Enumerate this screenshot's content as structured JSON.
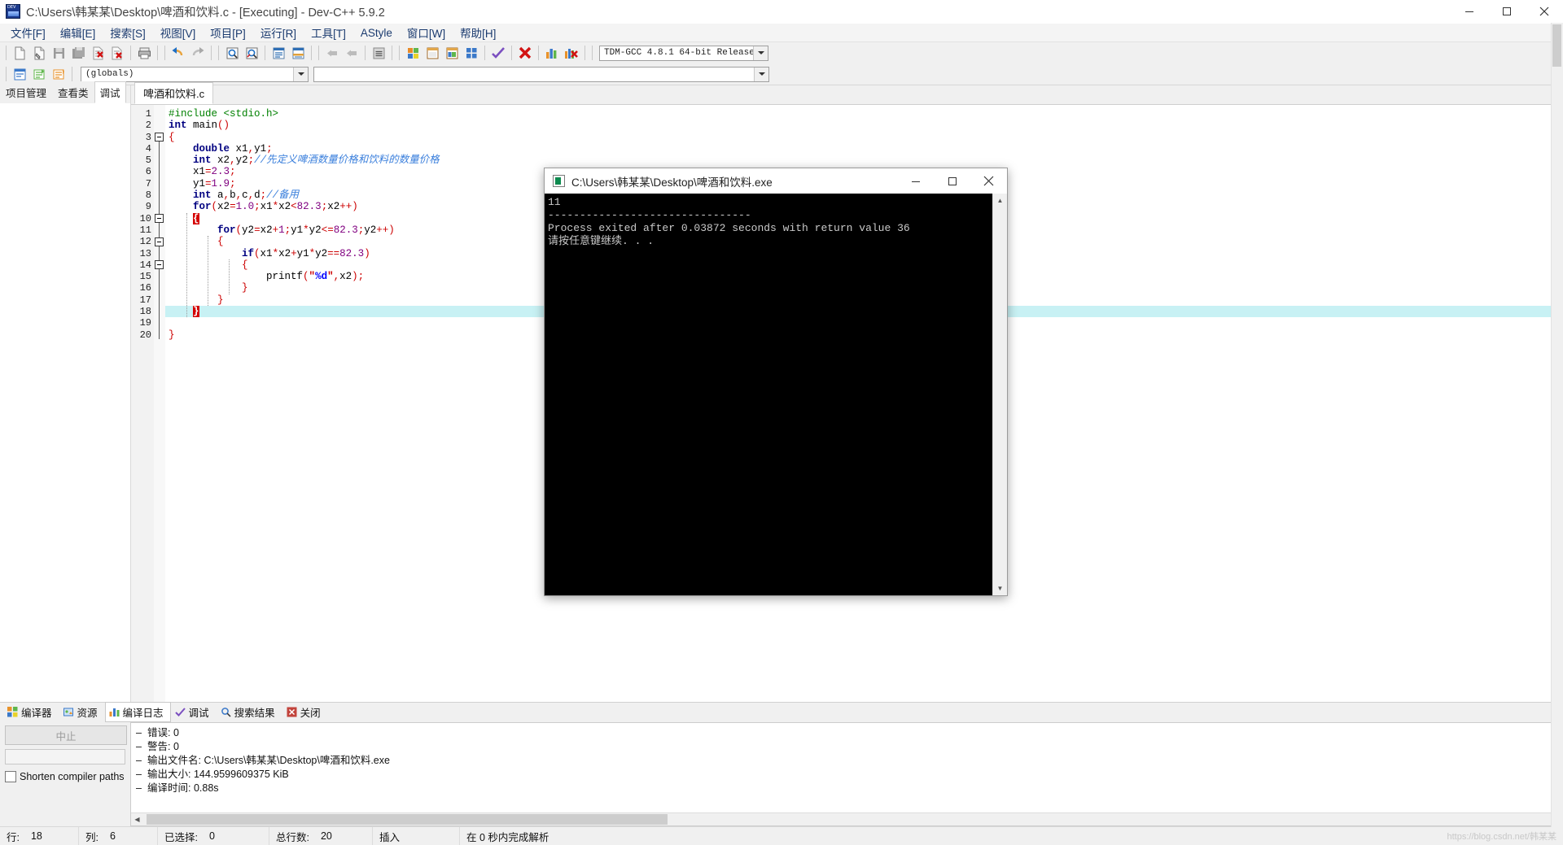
{
  "window": {
    "title": "C:\\Users\\韩某某\\Desktop\\啤酒和饮料.c - [Executing] - Dev-C++ 5.9.2",
    "minimize": "–",
    "maximize": "□",
    "close": "✕"
  },
  "menu": {
    "items": [
      {
        "label": "文件[F]",
        "name": "menu-file"
      },
      {
        "label": "编辑[E]",
        "name": "menu-edit"
      },
      {
        "label": "搜索[S]",
        "name": "menu-search"
      },
      {
        "label": "视图[V]",
        "name": "menu-view"
      },
      {
        "label": "项目[P]",
        "name": "menu-project"
      },
      {
        "label": "运行[R]",
        "name": "menu-run"
      },
      {
        "label": "工具[T]",
        "name": "menu-tools"
      },
      {
        "label": "AStyle",
        "name": "menu-astyle"
      },
      {
        "label": "窗口[W]",
        "name": "menu-window"
      },
      {
        "label": "帮助[H]",
        "name": "menu-help"
      }
    ]
  },
  "toolbar": {
    "compiler_combo": "TDM-GCC 4.8.1 64-bit Release",
    "globals_combo": "(globals)",
    "symbol_combo": ""
  },
  "left_panel": {
    "tabs": [
      {
        "label": "项目管理",
        "name": "tab-project-manager"
      },
      {
        "label": "查看类",
        "name": "tab-class-browser"
      },
      {
        "label": "调试",
        "name": "tab-debug"
      }
    ],
    "active": "调试"
  },
  "editor": {
    "tab_label": "啤酒和饮料.c",
    "current_line": 18,
    "total_lines": 20,
    "lines": [
      {
        "n": 1,
        "tokens": [
          {
            "t": "#include <stdio.h>",
            "c": "pp"
          }
        ]
      },
      {
        "n": 2,
        "tokens": [
          {
            "t": "int",
            "c": "k"
          },
          {
            "t": " main",
            "c": "id"
          },
          {
            "t": "()",
            "c": "op"
          }
        ]
      },
      {
        "n": 3,
        "tokens": [
          {
            "t": "{",
            "c": "op"
          }
        ]
      },
      {
        "n": 4,
        "tokens": [
          {
            "t": "    ",
            "c": "id"
          },
          {
            "t": "double",
            "c": "k"
          },
          {
            "t": " x1",
            "c": "id"
          },
          {
            "t": ",",
            "c": "op"
          },
          {
            "t": "y1",
            "c": "id"
          },
          {
            "t": ";",
            "c": "op"
          }
        ]
      },
      {
        "n": 5,
        "tokens": [
          {
            "t": "    ",
            "c": "id"
          },
          {
            "t": "int",
            "c": "k"
          },
          {
            "t": " x2",
            "c": "id"
          },
          {
            "t": ",",
            "c": "op"
          },
          {
            "t": "y2",
            "c": "id"
          },
          {
            "t": ";",
            "c": "op"
          },
          {
            "t": "//先定义啤酒数量价格和饮料的数量价格",
            "c": "cm"
          }
        ]
      },
      {
        "n": 6,
        "tokens": [
          {
            "t": "    x1",
            "c": "id"
          },
          {
            "t": "=",
            "c": "op"
          },
          {
            "t": "2.3",
            "c": "num"
          },
          {
            "t": ";",
            "c": "op"
          }
        ]
      },
      {
        "n": 7,
        "tokens": [
          {
            "t": "    y1",
            "c": "id"
          },
          {
            "t": "=",
            "c": "op"
          },
          {
            "t": "1.9",
            "c": "num"
          },
          {
            "t": ";",
            "c": "op"
          }
        ]
      },
      {
        "n": 8,
        "tokens": [
          {
            "t": "    ",
            "c": "id"
          },
          {
            "t": "int",
            "c": "k"
          },
          {
            "t": " a",
            "c": "id"
          },
          {
            "t": ",",
            "c": "op"
          },
          {
            "t": "b",
            "c": "id"
          },
          {
            "t": ",",
            "c": "op"
          },
          {
            "t": "c",
            "c": "id"
          },
          {
            "t": ",",
            "c": "op"
          },
          {
            "t": "d",
            "c": "id"
          },
          {
            "t": ";",
            "c": "op"
          },
          {
            "t": "//备用",
            "c": "cm"
          }
        ]
      },
      {
        "n": 9,
        "tokens": [
          {
            "t": "    ",
            "c": "id"
          },
          {
            "t": "for",
            "c": "k"
          },
          {
            "t": "(",
            "c": "op"
          },
          {
            "t": "x2",
            "c": "id"
          },
          {
            "t": "=",
            "c": "op"
          },
          {
            "t": "1.0",
            "c": "num"
          },
          {
            "t": ";",
            "c": "op"
          },
          {
            "t": "x1",
            "c": "id"
          },
          {
            "t": "*",
            "c": "op"
          },
          {
            "t": "x2",
            "c": "id"
          },
          {
            "t": "<",
            "c": "op"
          },
          {
            "t": "82.3",
            "c": "num"
          },
          {
            "t": ";",
            "c": "op"
          },
          {
            "t": "x2",
            "c": "id"
          },
          {
            "t": "++)",
            "c": "op"
          }
        ]
      },
      {
        "n": 10,
        "tokens": [
          {
            "t": "    ",
            "c": "id"
          },
          {
            "t": "{",
            "c": "bracehl"
          }
        ]
      },
      {
        "n": 11,
        "tokens": [
          {
            "t": "        ",
            "c": "id"
          },
          {
            "t": "for",
            "c": "k"
          },
          {
            "t": "(",
            "c": "op"
          },
          {
            "t": "y2",
            "c": "id"
          },
          {
            "t": "=",
            "c": "op"
          },
          {
            "t": "x2",
            "c": "id"
          },
          {
            "t": "+",
            "c": "op"
          },
          {
            "t": "1",
            "c": "num"
          },
          {
            "t": ";",
            "c": "op"
          },
          {
            "t": "y1",
            "c": "id"
          },
          {
            "t": "*",
            "c": "op"
          },
          {
            "t": "y2",
            "c": "id"
          },
          {
            "t": "<=",
            "c": "op"
          },
          {
            "t": "82.3",
            "c": "num"
          },
          {
            "t": ";",
            "c": "op"
          },
          {
            "t": "y2",
            "c": "id"
          },
          {
            "t": "++)",
            "c": "op"
          }
        ]
      },
      {
        "n": 12,
        "tokens": [
          {
            "t": "        ",
            "c": "id"
          },
          {
            "t": "{",
            "c": "op"
          }
        ]
      },
      {
        "n": 13,
        "tokens": [
          {
            "t": "            ",
            "c": "id"
          },
          {
            "t": "if",
            "c": "k"
          },
          {
            "t": "(",
            "c": "op"
          },
          {
            "t": "x1",
            "c": "id"
          },
          {
            "t": "*",
            "c": "op"
          },
          {
            "t": "x2",
            "c": "id"
          },
          {
            "t": "+",
            "c": "op"
          },
          {
            "t": "y1",
            "c": "id"
          },
          {
            "t": "*",
            "c": "op"
          },
          {
            "t": "y2",
            "c": "id"
          },
          {
            "t": "==",
            "c": "op"
          },
          {
            "t": "82.3",
            "c": "num"
          },
          {
            "t": ")",
            "c": "op"
          }
        ]
      },
      {
        "n": 14,
        "tokens": [
          {
            "t": "            ",
            "c": "id"
          },
          {
            "t": "{",
            "c": "op"
          }
        ]
      },
      {
        "n": 15,
        "tokens": [
          {
            "t": "                printf",
            "c": "id"
          },
          {
            "t": "(",
            "c": "op"
          },
          {
            "t": "\"",
            "c": "stq"
          },
          {
            "t": "%d",
            "c": "st"
          },
          {
            "t": "\"",
            "c": "stq"
          },
          {
            "t": ",",
            "c": "op"
          },
          {
            "t": "x2",
            "c": "id"
          },
          {
            "t": ")",
            "c": "op"
          },
          {
            "t": ";",
            "c": "op"
          }
        ]
      },
      {
        "n": 16,
        "tokens": [
          {
            "t": "            ",
            "c": "id"
          },
          {
            "t": "}",
            "c": "op"
          }
        ]
      },
      {
        "n": 17,
        "tokens": [
          {
            "t": "        ",
            "c": "id"
          },
          {
            "t": "}",
            "c": "op"
          }
        ]
      },
      {
        "n": 18,
        "tokens": [
          {
            "t": "    ",
            "c": "id"
          },
          {
            "t": "}",
            "c": "bracehl"
          }
        ]
      },
      {
        "n": 19,
        "tokens": []
      },
      {
        "n": 20,
        "tokens": [
          {
            "t": "}",
            "c": "op"
          }
        ]
      }
    ]
  },
  "console": {
    "title": "C:\\Users\\韩某某\\Desktop\\啤酒和饮料.exe",
    "minimize": "–",
    "maximize": "□",
    "close": "✕",
    "lines": [
      "11",
      "--------------------------------",
      "Process exited after 0.03872 seconds with return value 36",
      "请按任意键继续. . ."
    ]
  },
  "bottom_panel": {
    "tabs": [
      {
        "label": "编译器",
        "name": "tab-compiler"
      },
      {
        "label": "资源",
        "name": "tab-resources"
      },
      {
        "label": "编译日志",
        "name": "tab-compile-log"
      },
      {
        "label": "调试",
        "name": "tab-debug-log"
      },
      {
        "label": "搜索结果",
        "name": "tab-search-results"
      },
      {
        "label": "关闭",
        "name": "tab-close"
      }
    ],
    "active": "编译日志",
    "abort_button": "中止",
    "shorten_checkbox": "Shorten compiler paths",
    "log": [
      "错误: 0",
      "警告: 0",
      "输出文件名: C:\\Users\\韩某某\\Desktop\\啤酒和饮料.exe",
      "输出大小: 144.9599609375 KiB",
      "编译时间: 0.88s"
    ]
  },
  "statusbar": {
    "cells": [
      {
        "label": "行:",
        "value": "18",
        "name": "status-row"
      },
      {
        "label": "列:",
        "value": "6",
        "name": "status-col"
      },
      {
        "label": "已选择:",
        "value": "0",
        "name": "status-selected"
      },
      {
        "label": "总行数:",
        "value": "20",
        "name": "status-total-lines"
      },
      {
        "label": "插入",
        "value": "",
        "name": "status-insert-mode"
      },
      {
        "label": "在 0 秒内完成解析",
        "value": "",
        "name": "status-parse-time"
      }
    ],
    "watermark": "https://blog.csdn.net/韩某某"
  },
  "colors": {
    "accent": "#1b3b6f",
    "highlight_line": "#c8f1f4",
    "brace_highlight": "#d40000",
    "comment": "#3a7fdc",
    "keyword": "#000080",
    "number": "#800080",
    "operator": "#cc0000",
    "preprocessor": "#008000",
    "string": "#0000ff",
    "console_bg": "#000000"
  }
}
